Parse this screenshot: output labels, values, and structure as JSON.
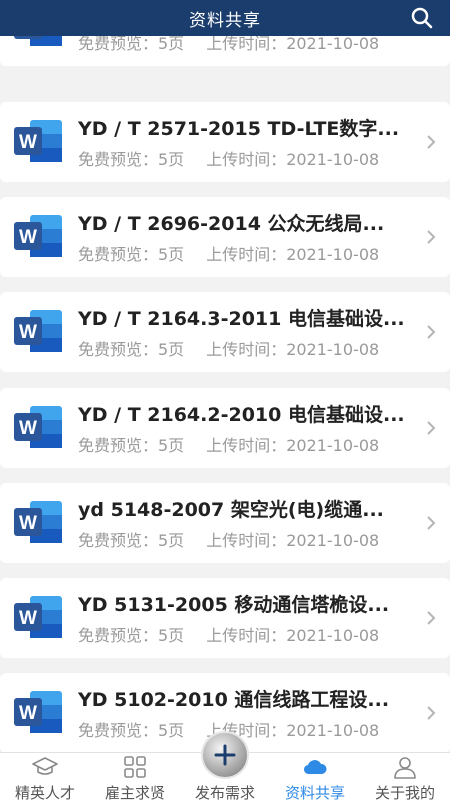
{
  "header": {
    "title": "资料共享"
  },
  "documents": [
    {
      "title": "",
      "preview": "免费预览：5页",
      "upload": "上传时间：2021-10-08"
    },
    {
      "title": "YD / T 2571-2015 TD-LTE数字...",
      "preview": "免费预览：5页",
      "upload": "上传时间：2021-10-08"
    },
    {
      "title": "YD / T 2696-2014 公众无线局...",
      "preview": "免费预览：5页",
      "upload": "上传时间：2021-10-08"
    },
    {
      "title": "YD / T 2164.3-2011 电信基础设...",
      "preview": "免费预览：5页",
      "upload": "上传时间：2021-10-08"
    },
    {
      "title": "YD / T 2164.2-2010 电信基础设...",
      "preview": "免费预览：5页",
      "upload": "上传时间：2021-10-08"
    },
    {
      "title": "yd 5148-2007 架空光(电)缆通...",
      "preview": "免费预览：5页",
      "upload": "上传时间：2021-10-08"
    },
    {
      "title": "YD 5131-2005 移动通信塔桅设...",
      "preview": "免费预览：5页",
      "upload": "上传时间：2021-10-08"
    },
    {
      "title": "YD 5102-2010 通信线路工程设...",
      "preview": "免费预览：5页",
      "upload": "上传时间：2021-10-08"
    }
  ],
  "tabs": [
    {
      "label": "精英人才",
      "icon": "graduation-cap-icon"
    },
    {
      "label": "雇主求贤",
      "icon": "grid-icon"
    },
    {
      "label": "发布需求",
      "icon": "plus-icon"
    },
    {
      "label": "资料共享",
      "icon": "cloud-icon",
      "active": true
    },
    {
      "label": "关于我的",
      "icon": "user-icon"
    }
  ],
  "colors": {
    "header": "#1a3d6e",
    "accent": "#2f8ae6",
    "word_blue": "#2b579a"
  }
}
